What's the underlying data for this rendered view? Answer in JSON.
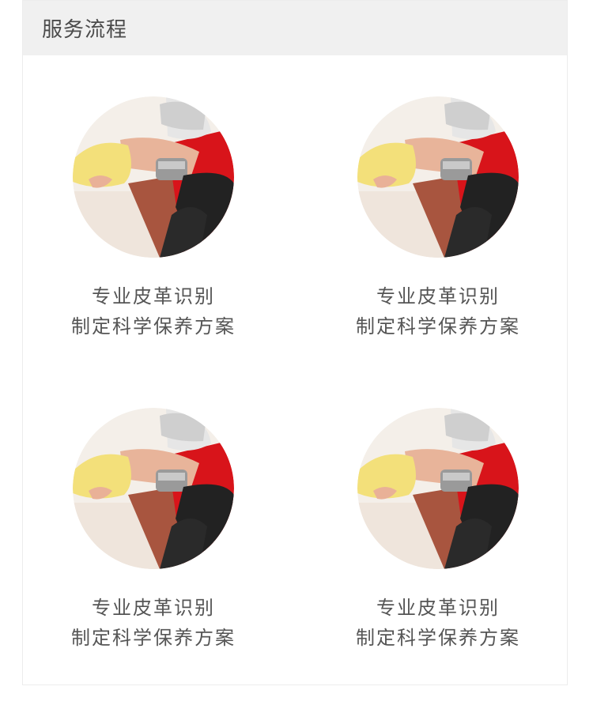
{
  "section": {
    "title": "服务流程"
  },
  "steps": [
    {
      "line1": "专业皮革识别",
      "line2": "制定科学保养方案",
      "image_icon": "leather-care-photo"
    },
    {
      "line1": "专业皮革识别",
      "line2": "制定科学保养方案",
      "image_icon": "leather-care-photo"
    },
    {
      "line1": "专业皮革识别",
      "line2": "制定科学保养方案",
      "image_icon": "leather-care-photo"
    },
    {
      "line1": "专业皮革识别",
      "line2": "制定科学保养方案",
      "image_icon": "leather-care-photo"
    }
  ],
  "colors": {
    "header_bg": "#f0f0f0",
    "title_text": "#4a4a4a",
    "caption_text": "#555555",
    "accent_red": "#d8141a"
  }
}
